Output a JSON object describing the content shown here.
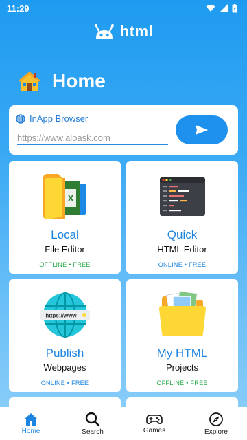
{
  "status": {
    "time": "11:29"
  },
  "app": {
    "title": "html"
  },
  "page": {
    "title": "Home"
  },
  "browser": {
    "label": "InApp Browser",
    "placeholder": "https://www.aloask.com"
  },
  "tiles": [
    {
      "title": "Local",
      "subtitle": "File Editor",
      "badge": "OFFLINE • FREE",
      "badge_color": "#2aa84a"
    },
    {
      "title": "Quick",
      "subtitle": "HTML Editor",
      "badge": "ONLINE • FREE",
      "badge_color": "#1d85e0"
    },
    {
      "title": "Publish",
      "subtitle": "Webpages",
      "badge": "ONLINE • FREE",
      "badge_color": "#1d85e0"
    },
    {
      "title": "My HTML",
      "subtitle": "Projects",
      "badge": "OFFLINE • FREE",
      "badge_color": "#2aa84a"
    }
  ],
  "nav": [
    {
      "label": "Home",
      "icon": "home-icon",
      "active": true
    },
    {
      "label": "Search",
      "icon": "search-icon",
      "active": false
    },
    {
      "label": "Games",
      "icon": "gamepad-icon",
      "active": false
    },
    {
      "label": "Explore",
      "icon": "compass-icon",
      "active": false
    }
  ],
  "colors": {
    "accent": "#1d85e0",
    "background_top": "#1e9bf0",
    "offline_green": "#2aa84a"
  }
}
